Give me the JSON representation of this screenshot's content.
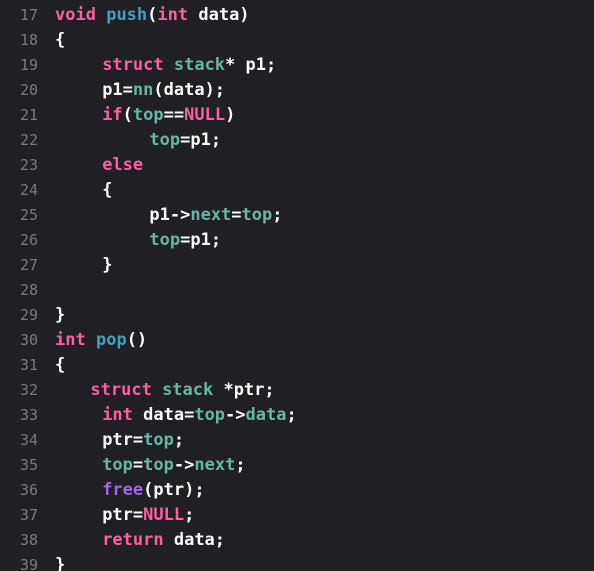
{
  "colors": {
    "background": "#1f1f24",
    "line_number": "#7b7c80",
    "plain": "#ffffff",
    "keyword": "#fc5fa3",
    "function": "#41a1c0",
    "identifier": "#67b7a4",
    "type": "#5dd8ff",
    "system_function": "#a167e6"
  },
  "lines": [
    {
      "n": "17",
      "indent": 0,
      "tokens": [
        {
          "t": "void",
          "c": "kw"
        },
        {
          "t": " ",
          "c": "pl"
        },
        {
          "t": "push",
          "c": "fn"
        },
        {
          "t": "(",
          "c": "pl"
        },
        {
          "t": "int",
          "c": "kw"
        },
        {
          "t": " data)",
          "c": "pl"
        }
      ]
    },
    {
      "n": "18",
      "indent": 0,
      "tokens": [
        {
          "t": "{",
          "c": "pl"
        }
      ]
    },
    {
      "n": "19",
      "indent": 4,
      "tokens": [
        {
          "t": "struct",
          "c": "kw"
        },
        {
          "t": " ",
          "c": "pl"
        },
        {
          "t": "stack",
          "c": "id"
        },
        {
          "t": "* p1;",
          "c": "pl"
        }
      ]
    },
    {
      "n": "20",
      "indent": 4,
      "tokens": [
        {
          "t": "p1=",
          "c": "pl"
        },
        {
          "t": "nn",
          "c": "id"
        },
        {
          "t": "(data);",
          "c": "pl"
        }
      ]
    },
    {
      "n": "21",
      "indent": 4,
      "tokens": [
        {
          "t": "if",
          "c": "kw"
        },
        {
          "t": "(",
          "c": "pl"
        },
        {
          "t": "top",
          "c": "id"
        },
        {
          "t": "==",
          "c": "pl"
        },
        {
          "t": "NULL",
          "c": "kw"
        },
        {
          "t": ")",
          "c": "pl"
        }
      ]
    },
    {
      "n": "22",
      "indent": 8,
      "tokens": [
        {
          "t": "top",
          "c": "id"
        },
        {
          "t": "=p1;",
          "c": "pl"
        }
      ]
    },
    {
      "n": "23",
      "indent": 4,
      "tokens": [
        {
          "t": "else",
          "c": "kw"
        }
      ]
    },
    {
      "n": "24",
      "indent": 4,
      "tokens": [
        {
          "t": "{",
          "c": "pl"
        }
      ]
    },
    {
      "n": "25",
      "indent": 8,
      "tokens": [
        {
          "t": "p1->",
          "c": "pl"
        },
        {
          "t": "next",
          "c": "id"
        },
        {
          "t": "=",
          "c": "pl"
        },
        {
          "t": "top",
          "c": "id"
        },
        {
          "t": ";",
          "c": "pl"
        }
      ]
    },
    {
      "n": "26",
      "indent": 8,
      "tokens": [
        {
          "t": "top",
          "c": "id"
        },
        {
          "t": "=p1;",
          "c": "pl"
        }
      ]
    },
    {
      "n": "27",
      "indent": 4,
      "tokens": [
        {
          "t": "}",
          "c": "pl"
        }
      ]
    },
    {
      "n": "28",
      "indent": 0,
      "tokens": []
    },
    {
      "n": "29",
      "indent": 0,
      "tokens": [
        {
          "t": "}",
          "c": "pl"
        }
      ]
    },
    {
      "n": "30",
      "indent": 0,
      "tokens": [
        {
          "t": "int",
          "c": "kw"
        },
        {
          "t": " ",
          "c": "pl"
        },
        {
          "t": "pop",
          "c": "fn"
        },
        {
          "t": "()",
          "c": "pl"
        }
      ]
    },
    {
      "n": "31",
      "indent": 0,
      "tokens": [
        {
          "t": "{",
          "c": "pl"
        }
      ]
    },
    {
      "n": "32",
      "indent": 3,
      "tokens": [
        {
          "t": "struct",
          "c": "kw"
        },
        {
          "t": " ",
          "c": "pl"
        },
        {
          "t": "stack",
          "c": "id"
        },
        {
          "t": " *ptr;",
          "c": "pl"
        }
      ]
    },
    {
      "n": "33",
      "indent": 4,
      "tokens": [
        {
          "t": "int",
          "c": "kw"
        },
        {
          "t": " data=",
          "c": "pl"
        },
        {
          "t": "top",
          "c": "id"
        },
        {
          "t": "->",
          "c": "pl"
        },
        {
          "t": "data",
          "c": "id"
        },
        {
          "t": ";",
          "c": "pl"
        }
      ]
    },
    {
      "n": "34",
      "indent": 4,
      "tokens": [
        {
          "t": "ptr=",
          "c": "pl"
        },
        {
          "t": "top",
          "c": "id"
        },
        {
          "t": ";",
          "c": "pl"
        }
      ]
    },
    {
      "n": "35",
      "indent": 4,
      "tokens": [
        {
          "t": "top",
          "c": "id"
        },
        {
          "t": "=",
          "c": "pl"
        },
        {
          "t": "top",
          "c": "id"
        },
        {
          "t": "->",
          "c": "pl"
        },
        {
          "t": "next",
          "c": "id"
        },
        {
          "t": ";",
          "c": "pl"
        }
      ]
    },
    {
      "n": "36",
      "indent": 4,
      "tokens": [
        {
          "t": "free",
          "c": "sy"
        },
        {
          "t": "(ptr);",
          "c": "pl"
        }
      ]
    },
    {
      "n": "37",
      "indent": 4,
      "tokens": [
        {
          "t": "ptr=",
          "c": "pl"
        },
        {
          "t": "NULL",
          "c": "kw"
        },
        {
          "t": ";",
          "c": "pl"
        }
      ]
    },
    {
      "n": "38",
      "indent": 4,
      "tokens": [
        {
          "t": "return",
          "c": "kw"
        },
        {
          "t": " data;",
          "c": "pl"
        }
      ]
    },
    {
      "n": "39",
      "indent": 0,
      "tokens": [
        {
          "t": "}",
          "c": "pl"
        }
      ]
    }
  ]
}
